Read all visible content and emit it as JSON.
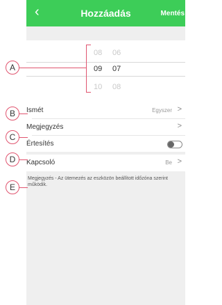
{
  "header": {
    "back_icon": "chevron-left-icon",
    "title": "Hozzáadás",
    "save_label": "Mentés"
  },
  "picker": {
    "rows": [
      {
        "hour": "08",
        "minute": "06"
      },
      {
        "hour": "09",
        "minute": "07"
      },
      {
        "hour": "10",
        "minute": "08"
      }
    ]
  },
  "settings": {
    "repeat": {
      "label": "Ismét",
      "value": "Egyszer"
    },
    "note": {
      "label": "Megjegyzés"
    },
    "notification": {
      "label": "Értesítés",
      "state": "off"
    },
    "switch": {
      "label": "Kapcsoló",
      "value": "Be"
    }
  },
  "footnote": "Megjegyzés - Az ütemezés az eszközön beállított időzóna szerint működik.",
  "callouts": [
    "A",
    "B",
    "C",
    "D",
    "E"
  ],
  "colors": {
    "header_bg": "#3dcd58",
    "callout": "#e0546f"
  }
}
